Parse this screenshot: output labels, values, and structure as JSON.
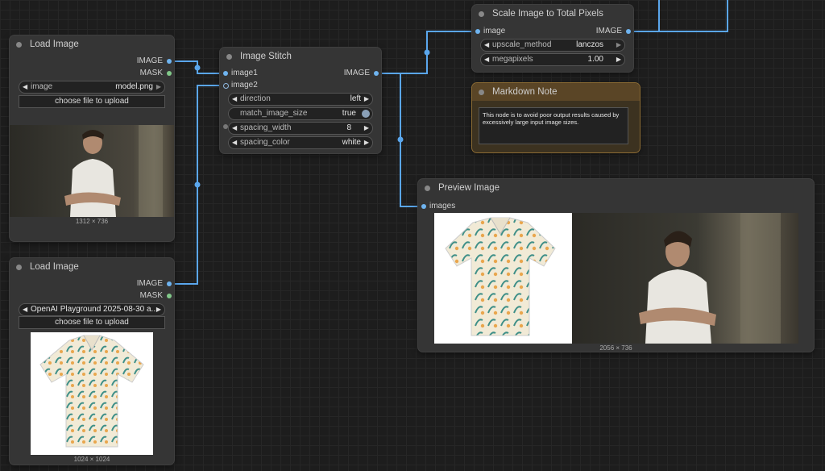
{
  "colors": {
    "wire": "#5aa6ec",
    "note_header": "#5a4526",
    "note_body": "#3c3220",
    "note_border": "#8a6a33"
  },
  "load1": {
    "title": "Load Image",
    "out_image": "IMAGE",
    "out_mask": "MASK",
    "image_label": "image",
    "image_value": "model.png",
    "upload": "choose file to upload",
    "caption": "1312 × 736"
  },
  "load2": {
    "title": "Load Image",
    "out_image": "IMAGE",
    "out_mask": "MASK",
    "image_value": "OpenAI Playground 2025-08-30 a...",
    "upload": "choose file to upload",
    "caption": "1024 × 1024"
  },
  "stitch": {
    "title": "Image Stitch",
    "in1": "image1",
    "in2": "image2",
    "out": "IMAGE",
    "w_direction": {
      "label": "direction",
      "value": "left"
    },
    "w_match": {
      "label": "match_image_size",
      "value": "true"
    },
    "w_spacing": {
      "label": "spacing_width",
      "value": "8"
    },
    "w_color": {
      "label": "spacing_color",
      "value": "white"
    }
  },
  "scale": {
    "title": "Scale Image to Total Pixels",
    "in": "image",
    "out": "IMAGE",
    "w_method": {
      "label": "upscale_method",
      "value": "lanczos"
    },
    "w_mp": {
      "label": "megapixels",
      "value": "1.00"
    }
  },
  "note": {
    "title": "Markdown Note",
    "text": "This node is to avoid poor output results caused by excessively large input image sizes."
  },
  "preview": {
    "title": "Preview Image",
    "in": "images",
    "caption": "2056 × 736"
  }
}
